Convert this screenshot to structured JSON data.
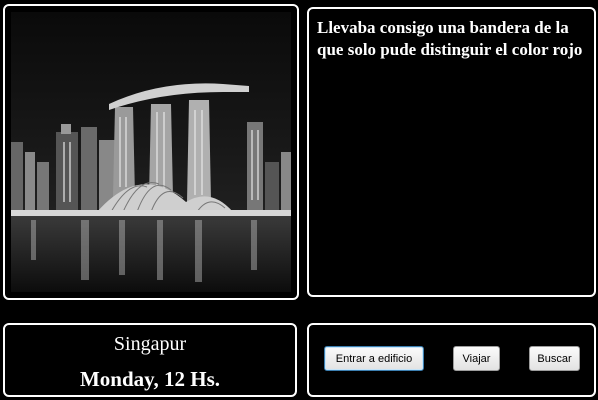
{
  "story": {
    "text": "Llevaba consigo una bandera de la que solo pude distinguir el color rojo"
  },
  "location": {
    "city": "Singapur",
    "datetime": "Monday, 12 Hs."
  },
  "actions": {
    "enter_building": "Entrar a edificio",
    "travel": "Viajar",
    "search": "Buscar"
  },
  "colors": {
    "background": "#000000",
    "panel_border": "#ffffff",
    "text": "#ffffff"
  }
}
